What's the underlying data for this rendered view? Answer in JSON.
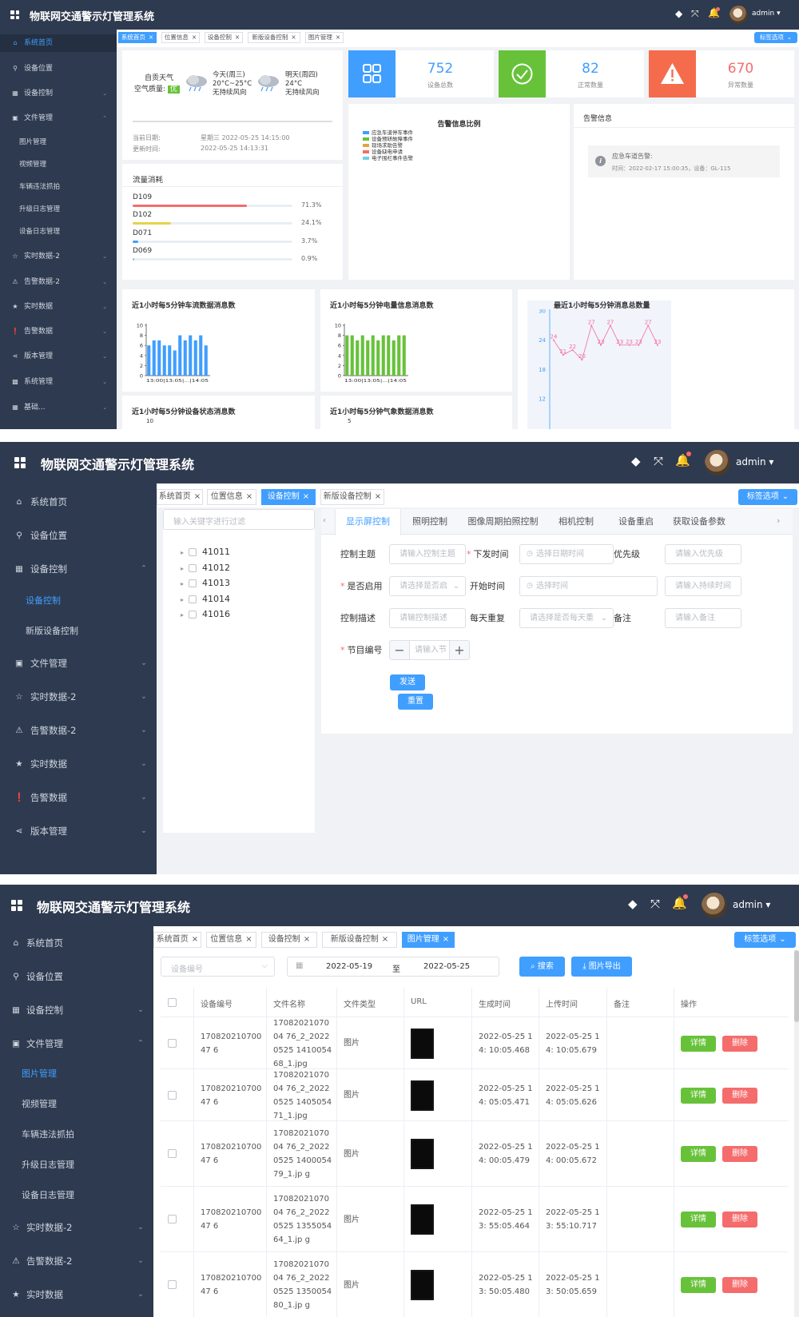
{
  "app": {
    "title": "物联网交通警示灯管理系统",
    "user": "admin"
  },
  "sidebar_p1": [
    "系统首页",
    "设备位置",
    "设备控制",
    "文件管理",
    "图片管理",
    "视频管理",
    "车辆违法抓拍",
    "升级日志管理",
    "设备日志管理",
    "实时数据-2",
    "告警数据-2",
    "实时数据",
    "告警数据",
    "版本管理",
    "系统管理",
    "基础..."
  ],
  "sidebar_p2": [
    "系统首页",
    "设备位置",
    "设备控制",
    "设备控制",
    "新版设备控制",
    "文件管理",
    "实时数据-2",
    "告警数据-2",
    "实时数据",
    "告警数据",
    "版本管理"
  ],
  "sidebar_p3": [
    "系统首页",
    "设备位置",
    "设备控制",
    "文件管理",
    "图片管理",
    "视频管理",
    "车辆违法抓拍",
    "升级日志管理",
    "设备日志管理",
    "实时数据-2",
    "告警数据-2",
    "实时数据"
  ],
  "tabs_p1": [
    "系统首页",
    "位置信息",
    "设备控制",
    "新版设备控制",
    "图片管理"
  ],
  "tabs_p2": [
    "系统首页",
    "位置信息",
    "设备控制",
    "新版设备控制"
  ],
  "tabs_p3": [
    "系统首页",
    "位置信息",
    "设备控制",
    "新版设备控制",
    "图片管理"
  ],
  "tab_options": "标签选项",
  "weather": {
    "city": "自贡天气",
    "air_label": "空气质量:",
    "air_value": "优",
    "today": {
      "day": "今天(周三)",
      "temp": "20°C~25°C",
      "wind": "无持续风向"
    },
    "tomorrow": {
      "day": "明天(周四)",
      "temp": "24°C",
      "wind": "无持续风向"
    },
    "date_label": "当前日期:",
    "date_value": "星期三 2022-05-25 14:15:00",
    "update_label": "更新时间:",
    "update_value": "2022-05-25 14:13:31"
  },
  "stats": [
    {
      "value": "752",
      "label": "设备总数",
      "color": "#409eff"
    },
    {
      "value": "82",
      "label": "正常数量",
      "color": "#67c23a"
    },
    {
      "value": "670",
      "label": "异常数量",
      "color": "#f56c6c"
    }
  ],
  "alarm_ratio": {
    "title": "告警信息比例",
    "legend": [
      {
        "name": "应急车道停车事件",
        "color": "#409eff"
      },
      {
        "name": "设备预研故障事件",
        "color": "#67c23a"
      },
      {
        "name": "现场求助告警",
        "color": "#e6a23c"
      },
      {
        "name": "设备缺电申请",
        "color": "#f56c6c"
      },
      {
        "name": "电子围栏事件告警",
        "color": "#73d1e8"
      }
    ]
  },
  "alarm_info": {
    "title": "告警信息",
    "item_title": "应急车道告警:",
    "item_detail": "时间：2022-02-17 15:00:35，设备：GL-115"
  },
  "traffic": {
    "title": "流量消耗",
    "items": [
      {
        "name": "D109",
        "pct": "71.3%",
        "value": 71.3,
        "color": "#f56c6c"
      },
      {
        "name": "D102",
        "pct": "24.1%",
        "value": 24.1,
        "color": "#e6d34a"
      },
      {
        "name": "D071",
        "pct": "3.7%",
        "value": 3.7,
        "color": "#409eff"
      },
      {
        "name": "D069",
        "pct": "0.9%",
        "value": 0.9,
        "color": "#73d1e8"
      }
    ]
  },
  "chart_titles": {
    "traffic_flow": "近1小时每5分钟车流数据消息数",
    "power": "近1小时每5分钟电量信息消息数",
    "total": "最近1小时每5分钟消息总数量",
    "device_status": "近1小时每5分钟设备状态消息数",
    "weather": "近1小时每5分钟气象数据消息数"
  },
  "chart_data": [
    {
      "type": "bar",
      "title": "近1小时每5分钟车流数据消息数",
      "ylim": [
        0,
        10
      ],
      "yticks": [
        0,
        2,
        4,
        6,
        8,
        10
      ],
      "color": "#409eff",
      "x_ticks_label": "13:00|13:05|...|14:05",
      "values": [
        6,
        7,
        7,
        6,
        6,
        5,
        8,
        7,
        8,
        7,
        8,
        6
      ]
    },
    {
      "type": "bar",
      "title": "近1小时每5分钟电量信息消息数",
      "ylim": [
        0,
        10
      ],
      "yticks": [
        0,
        2,
        4,
        6,
        8,
        10
      ],
      "color": "#67c23a",
      "x_ticks_label": "13:00|13:05|...|14:05",
      "values": [
        8,
        8,
        7,
        8,
        7,
        8,
        7,
        8,
        8,
        7,
        8,
        8
      ]
    },
    {
      "type": "line",
      "title": "最近1小时每5分钟消息总数量",
      "ylim": [
        12,
        30
      ],
      "yticks": [
        12,
        18,
        24,
        30
      ],
      "color": "#f56c9a",
      "values": [
        24,
        21,
        22,
        20,
        27,
        23,
        27,
        23,
        23,
        23,
        27,
        23
      ]
    },
    {
      "type": "bar",
      "title": "近1小时每5分钟设备状态消息数",
      "ylim": [
        0,
        10
      ],
      "yticks": [
        10
      ],
      "values": []
    },
    {
      "type": "bar",
      "title": "近1小时每5分钟气象数据消息数",
      "ylim": [
        0,
        5
      ],
      "yticks": [
        5
      ],
      "values": []
    }
  ],
  "control": {
    "filter_placeholder": "输入关键字进行过滤",
    "tree": [
      "41011",
      "41012",
      "41013",
      "41014",
      "41016"
    ],
    "tabs": [
      "显示屏控制",
      "照明控制",
      "图像周期拍照控制",
      "相机控制",
      "设备重启",
      "获取设备参数"
    ],
    "form": {
      "subject_label": "控制主题",
      "subject_ph": "请输入控制主题",
      "issue_label": "下发时间",
      "issue_ph": "选择日期时间",
      "priority_label": "优先级",
      "priority_ph": "请输入优先级",
      "enable_label": "是否启用",
      "enable_ph": "请选择是否启",
      "start_label": "开始时间",
      "start_ph": "选择时间",
      "duration_ph": "请输入持续时间",
      "desc_label": "控制描述",
      "desc_ph": "请输控制描述",
      "repeat_label": "每天重复",
      "repeat_ph": "请选择是否每天重",
      "note_label": "备注",
      "note_ph": "请输入备注",
      "program_label": "节目编号",
      "program_ph": "请输入节",
      "send": "发送",
      "reset": "重置"
    }
  },
  "images": {
    "device_ph": "设备编号",
    "date_from": "2022-05-19",
    "date_to": "2022-05-25",
    "date_sep": "至",
    "search": "搜索",
    "export": "图片导出",
    "columns": [
      "设备编号",
      "文件名称",
      "文件类型",
      "URL",
      "生成时间",
      "上传时间",
      "备注",
      "操作"
    ],
    "detail": "详情",
    "delete": "删除",
    "rows": [
      {
        "dev": "17082021070047 6",
        "file": "1708202107004 76_2_20220525 141005468_1.jpg",
        "type": "图片",
        "gen": "2022-05-25 14: 10:05.468",
        "up": "2022-05-25 14: 10:05.679"
      },
      {
        "dev": "17082021070047 6",
        "file": "1708202107004 76_2_20220525 140505471_1.jpg",
        "type": "图片",
        "gen": "2022-05-25 14: 05:05.471",
        "up": "2022-05-25 14: 05:05.626"
      },
      {
        "dev": "17082021070047 6",
        "file": "1708202107004 76_2_20220525 140005479_1.jp g",
        "type": "图片",
        "gen": "2022-05-25 14: 00:05.479",
        "up": "2022-05-25 14: 00:05.672"
      },
      {
        "dev": "17082021070047 6",
        "file": "1708202107004 76_2_20220525 135505464_1.jp g",
        "type": "图片",
        "gen": "2022-05-25 13: 55:05.464",
        "up": "2022-05-25 13: 55:10.717"
      },
      {
        "dev": "17082021070047 6",
        "file": "1708202107004 76_2_20220525 135005480_1.jp g",
        "type": "图片",
        "gen": "2022-05-25 13: 50:05.480",
        "up": "2022-05-25 13: 50:05.659"
      }
    ]
  }
}
